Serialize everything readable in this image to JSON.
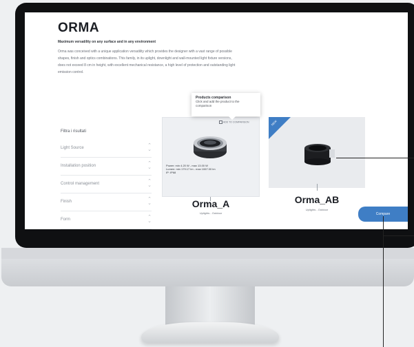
{
  "page": {
    "title": "ORMA",
    "subtitle": "Maximum versatility on any surface and in any environment",
    "description": "Orma was conceived with a unique application versatility which provides the designer with a vast range of possible shapes, finish and optics combinations. This family, in its uplight, downlight and wall-mounted light fixture versions, does not exceed 8 cm in height, with excellent mechanical resistance, a high level of protection and outstanding light emission control."
  },
  "filters": {
    "title": "Filtra i risultati",
    "items": [
      {
        "label": "Light Source"
      },
      {
        "label": "Installation position"
      },
      {
        "label": "Control management"
      },
      {
        "label": "Finish"
      },
      {
        "label": "Form"
      }
    ]
  },
  "tooltip": {
    "title": "Products comparison",
    "text": "Click and add the product to the comparison"
  },
  "products": [
    {
      "name": "Orma_A",
      "category": "Uplights - Outdoor",
      "compare_label": "ADD TO COMPARISON",
      "specs": [
        "Power: min 4.20 W - max 13.00 W",
        "Lumen: min 179.17 lm - max 1067.00 lm",
        "IP: IP68"
      ]
    },
    {
      "name": "Orma_AB",
      "category": "Uplights - Outdoor",
      "badge": "NEW"
    }
  ],
  "compare_button": "Compare",
  "colors": {
    "accent": "#3f7ec5",
    "bezel": "#0f1012",
    "text": "#1b1e24"
  }
}
